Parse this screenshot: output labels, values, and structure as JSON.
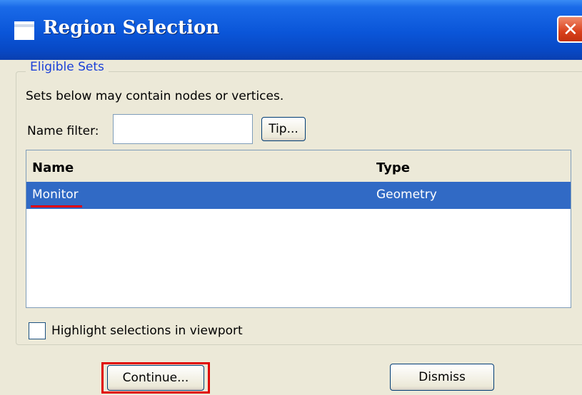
{
  "window": {
    "title": "Region Selection",
    "close_glyph": "✕",
    "title_bar_color": "#0a55d8",
    "body_color": "#ece9d8"
  },
  "group": {
    "legend": "Eligible Sets",
    "legend_color": "#1a3fd8"
  },
  "description": "Sets below may contain nodes or vertices.",
  "filter": {
    "label": "Name filter:",
    "value": "",
    "placeholder": "",
    "tip_label": "Tip..."
  },
  "table": {
    "columns": [
      "Name",
      "Type"
    ],
    "rows": [
      {
        "name": "Monitor",
        "type": "Geometry",
        "selected": true
      }
    ],
    "selection_color": "#316ac5"
  },
  "highlight_checkbox": {
    "label": "Highlight selections in viewport",
    "checked": false
  },
  "buttons": {
    "continue_label": "Continue...",
    "dismiss_label": "Dismiss"
  },
  "annotation_color": "#e00000",
  "icons": [
    "window-icon",
    "close-icon"
  ]
}
